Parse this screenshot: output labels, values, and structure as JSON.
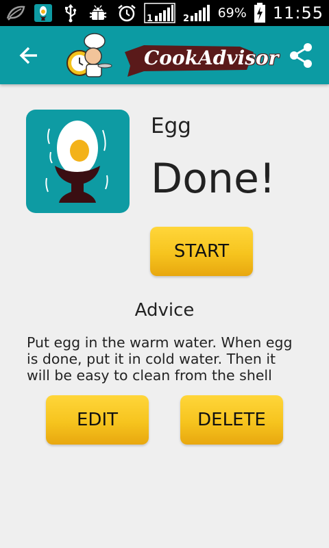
{
  "status_bar": {
    "icons": [
      "leaf-icon",
      "app-notification-icon",
      "usb-icon",
      "android-debug-icon",
      "alarm-icon",
      "signal-sim1-icon",
      "signal-sim2-icon",
      "battery-charging-icon"
    ],
    "sim1_label": "1",
    "sim2_label": "2",
    "battery": "69%",
    "time": "11:55"
  },
  "action_bar": {
    "app_name": "CookAdvisor",
    "icons": [
      "back-arrow-icon",
      "chef-logo-icon",
      "share-icon"
    ],
    "color": "#0c9ba3"
  },
  "recipe": {
    "name": "Egg",
    "status": "Done!",
    "image_icon": "egg-in-cup-icon",
    "start_label": "START"
  },
  "advice": {
    "heading": "Advice",
    "text": "Put egg in the warm water. When egg is done, put it in cold water. Then it will be easy to clean from the shell"
  },
  "actions": {
    "edit_label": "EDIT",
    "delete_label": "DELETE"
  },
  "colors": {
    "accent": "#0c9ba3",
    "button": "#f6c41e",
    "background": "#efefef"
  }
}
